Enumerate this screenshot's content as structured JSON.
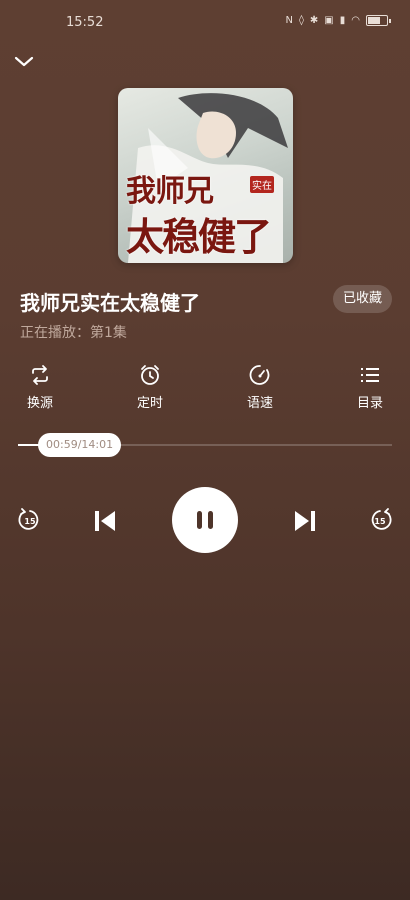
{
  "status": {
    "time": "15:52"
  },
  "cover": {
    "line1": "我师兄",
    "stamp": "实在",
    "line2": "太稳健了"
  },
  "book": {
    "title": "我师兄实在太稳健了",
    "favorite_label": "已收藏",
    "now_playing": "正在播放：第1集"
  },
  "actions": [
    {
      "label": "换源",
      "icon": "switch-source-icon"
    },
    {
      "label": "定时",
      "icon": "alarm-clock-icon"
    },
    {
      "label": "语速",
      "icon": "speed-gauge-icon"
    },
    {
      "label": "目录",
      "icon": "list-icon"
    }
  ],
  "progress": {
    "label": "00:59/14:01",
    "fraction": 0.07
  },
  "colors": {
    "background": "#5b3d31",
    "muted_text": "#bfa89c"
  }
}
